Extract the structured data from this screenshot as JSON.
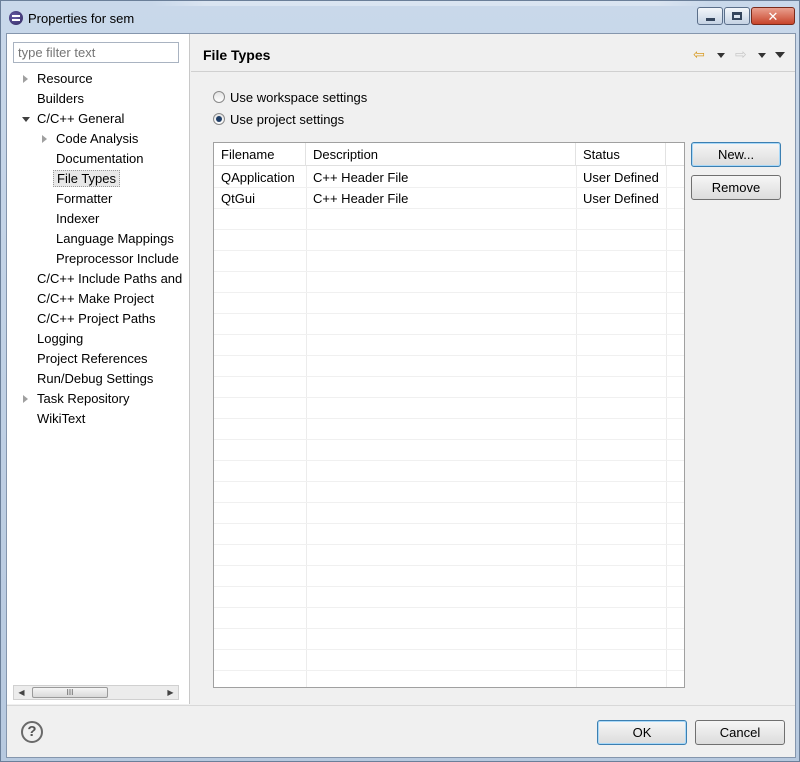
{
  "window": {
    "title": "Properties for sem"
  },
  "filter": {
    "placeholder": "type filter text"
  },
  "tree": [
    {
      "label": "Resource",
      "level": 0,
      "expander": "collapsed"
    },
    {
      "label": "Builders",
      "level": 0,
      "expander": "none"
    },
    {
      "label": "C/C++ General",
      "level": 0,
      "expander": "expanded"
    },
    {
      "label": "Code Analysis",
      "level": 1,
      "expander": "collapsed"
    },
    {
      "label": "Documentation",
      "level": 1,
      "expander": "none"
    },
    {
      "label": "File Types",
      "level": 1,
      "expander": "none",
      "selected": true
    },
    {
      "label": "Formatter",
      "level": 1,
      "expander": "none"
    },
    {
      "label": "Indexer",
      "level": 1,
      "expander": "none"
    },
    {
      "label": "Language Mappings",
      "level": 1,
      "expander": "none"
    },
    {
      "label": "Preprocessor Include",
      "level": 1,
      "expander": "none"
    },
    {
      "label": "C/C++ Include Paths and",
      "level": 0,
      "expander": "none"
    },
    {
      "label": "C/C++ Make Project",
      "level": 0,
      "expander": "none"
    },
    {
      "label": "C/C++ Project Paths",
      "level": 0,
      "expander": "none"
    },
    {
      "label": "Logging",
      "level": 0,
      "expander": "none"
    },
    {
      "label": "Project References",
      "level": 0,
      "expander": "none"
    },
    {
      "label": "Run/Debug Settings",
      "level": 0,
      "expander": "none"
    },
    {
      "label": "Task Repository",
      "level": 0,
      "expander": "collapsed"
    },
    {
      "label": "WikiText",
      "level": 0,
      "expander": "none"
    }
  ],
  "page": {
    "title": "File Types",
    "radio_workspace": "Use workspace settings",
    "radio_project": "Use project settings",
    "selected_radio": "project"
  },
  "table": {
    "columns": [
      "Filename",
      "Description",
      "Status"
    ],
    "rows": [
      [
        "QApplication",
        "C++ Header File",
        "User Defined"
      ],
      [
        "QtGui",
        "C++ Header File",
        "User Defined"
      ]
    ]
  },
  "buttons": {
    "new": "New...",
    "remove": "Remove",
    "ok": "OK",
    "cancel": "Cancel"
  },
  "scrollbar": {
    "thumb_grip": "III"
  },
  "icons": {
    "help": "?",
    "close": "✕",
    "back": "⇦",
    "forward": "⇨",
    "scroll_left": "◀",
    "scroll_right": "▶"
  }
}
